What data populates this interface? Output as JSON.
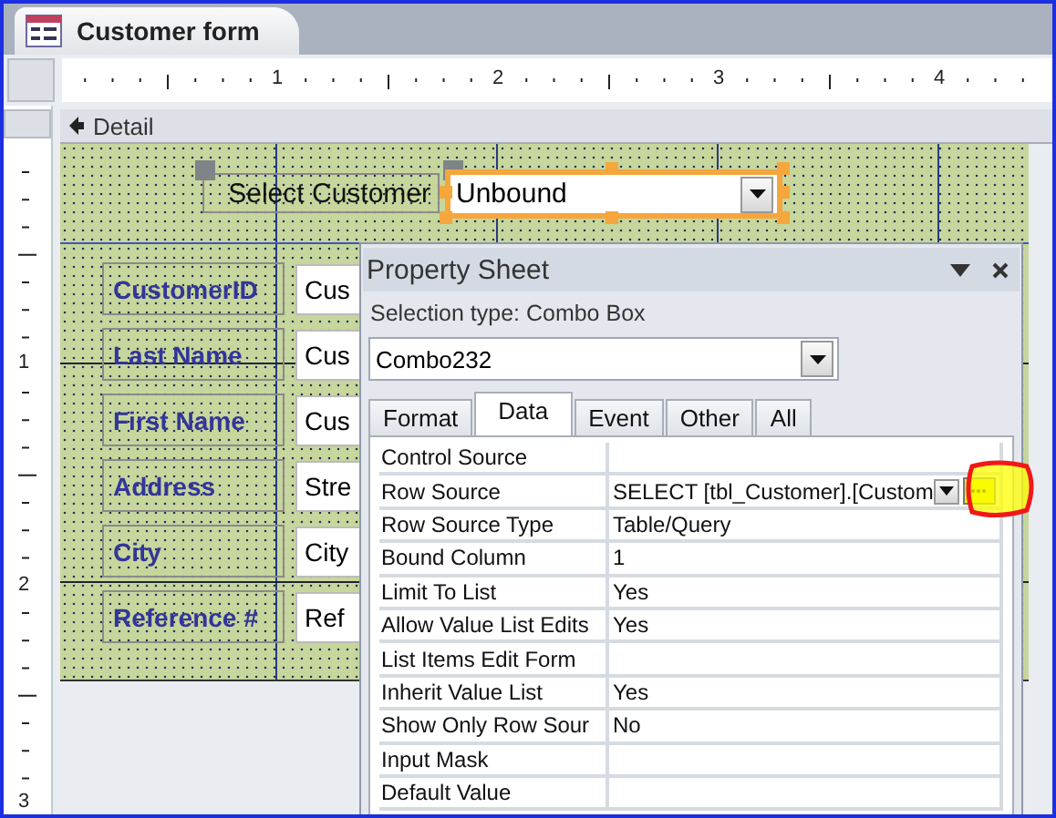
{
  "document_tab": {
    "title": "Customer form",
    "selected": true
  },
  "horizontal_ruler": {
    "marks": [
      "1",
      "2",
      "3",
      "4"
    ]
  },
  "vertical_ruler": {
    "marks": [
      "1",
      "2",
      "3"
    ]
  },
  "section": {
    "title": "Detail"
  },
  "selector": {
    "label": "Select Customer",
    "value": "Unbound"
  },
  "fields": [
    {
      "label": "CustomerID",
      "value": "Cus"
    },
    {
      "label": "Last Name",
      "value": "Cus"
    },
    {
      "label": "First Name",
      "value": "Cus"
    },
    {
      "label": "Address",
      "value": "Stre"
    },
    {
      "label": "City",
      "value": "City"
    },
    {
      "label": "Reference #",
      "value": "Ref"
    }
  ],
  "property_sheet": {
    "title": "Property Sheet",
    "selection_type": "Selection type:  Combo Box",
    "object": "Combo232",
    "tabs": [
      {
        "label": "Format",
        "selected": false
      },
      {
        "label": "Data",
        "selected": true
      },
      {
        "label": "Event",
        "selected": false
      },
      {
        "label": "Other",
        "selected": false
      },
      {
        "label": "All",
        "selected": false
      }
    ],
    "properties": [
      {
        "name": "Control Source",
        "kind": "text"
      },
      {
        "name": "Row Source",
        "value": "SELECT [tbl_Customer].[Custom",
        "kind": "builder"
      },
      {
        "name": "Row Source Type",
        "value": "Table/Query",
        "kind": "text"
      },
      {
        "name": "Bound Column",
        "value": "1",
        "kind": "text"
      },
      {
        "name": "Limit To List",
        "value": "Yes",
        "kind": "text"
      },
      {
        "name": "Allow Value List Edits",
        "value": "Yes",
        "kind": "text"
      },
      {
        "name": "List Items Edit Form",
        "kind": "text"
      },
      {
        "name": "Inherit Value List",
        "value": "Yes",
        "kind": "text"
      },
      {
        "name": "Show Only Row Sour",
        "value": "No",
        "kind": "text"
      },
      {
        "name": "Input Mask",
        "kind": "text"
      },
      {
        "name": "Default Value",
        "kind": "text"
      }
    ]
  }
}
